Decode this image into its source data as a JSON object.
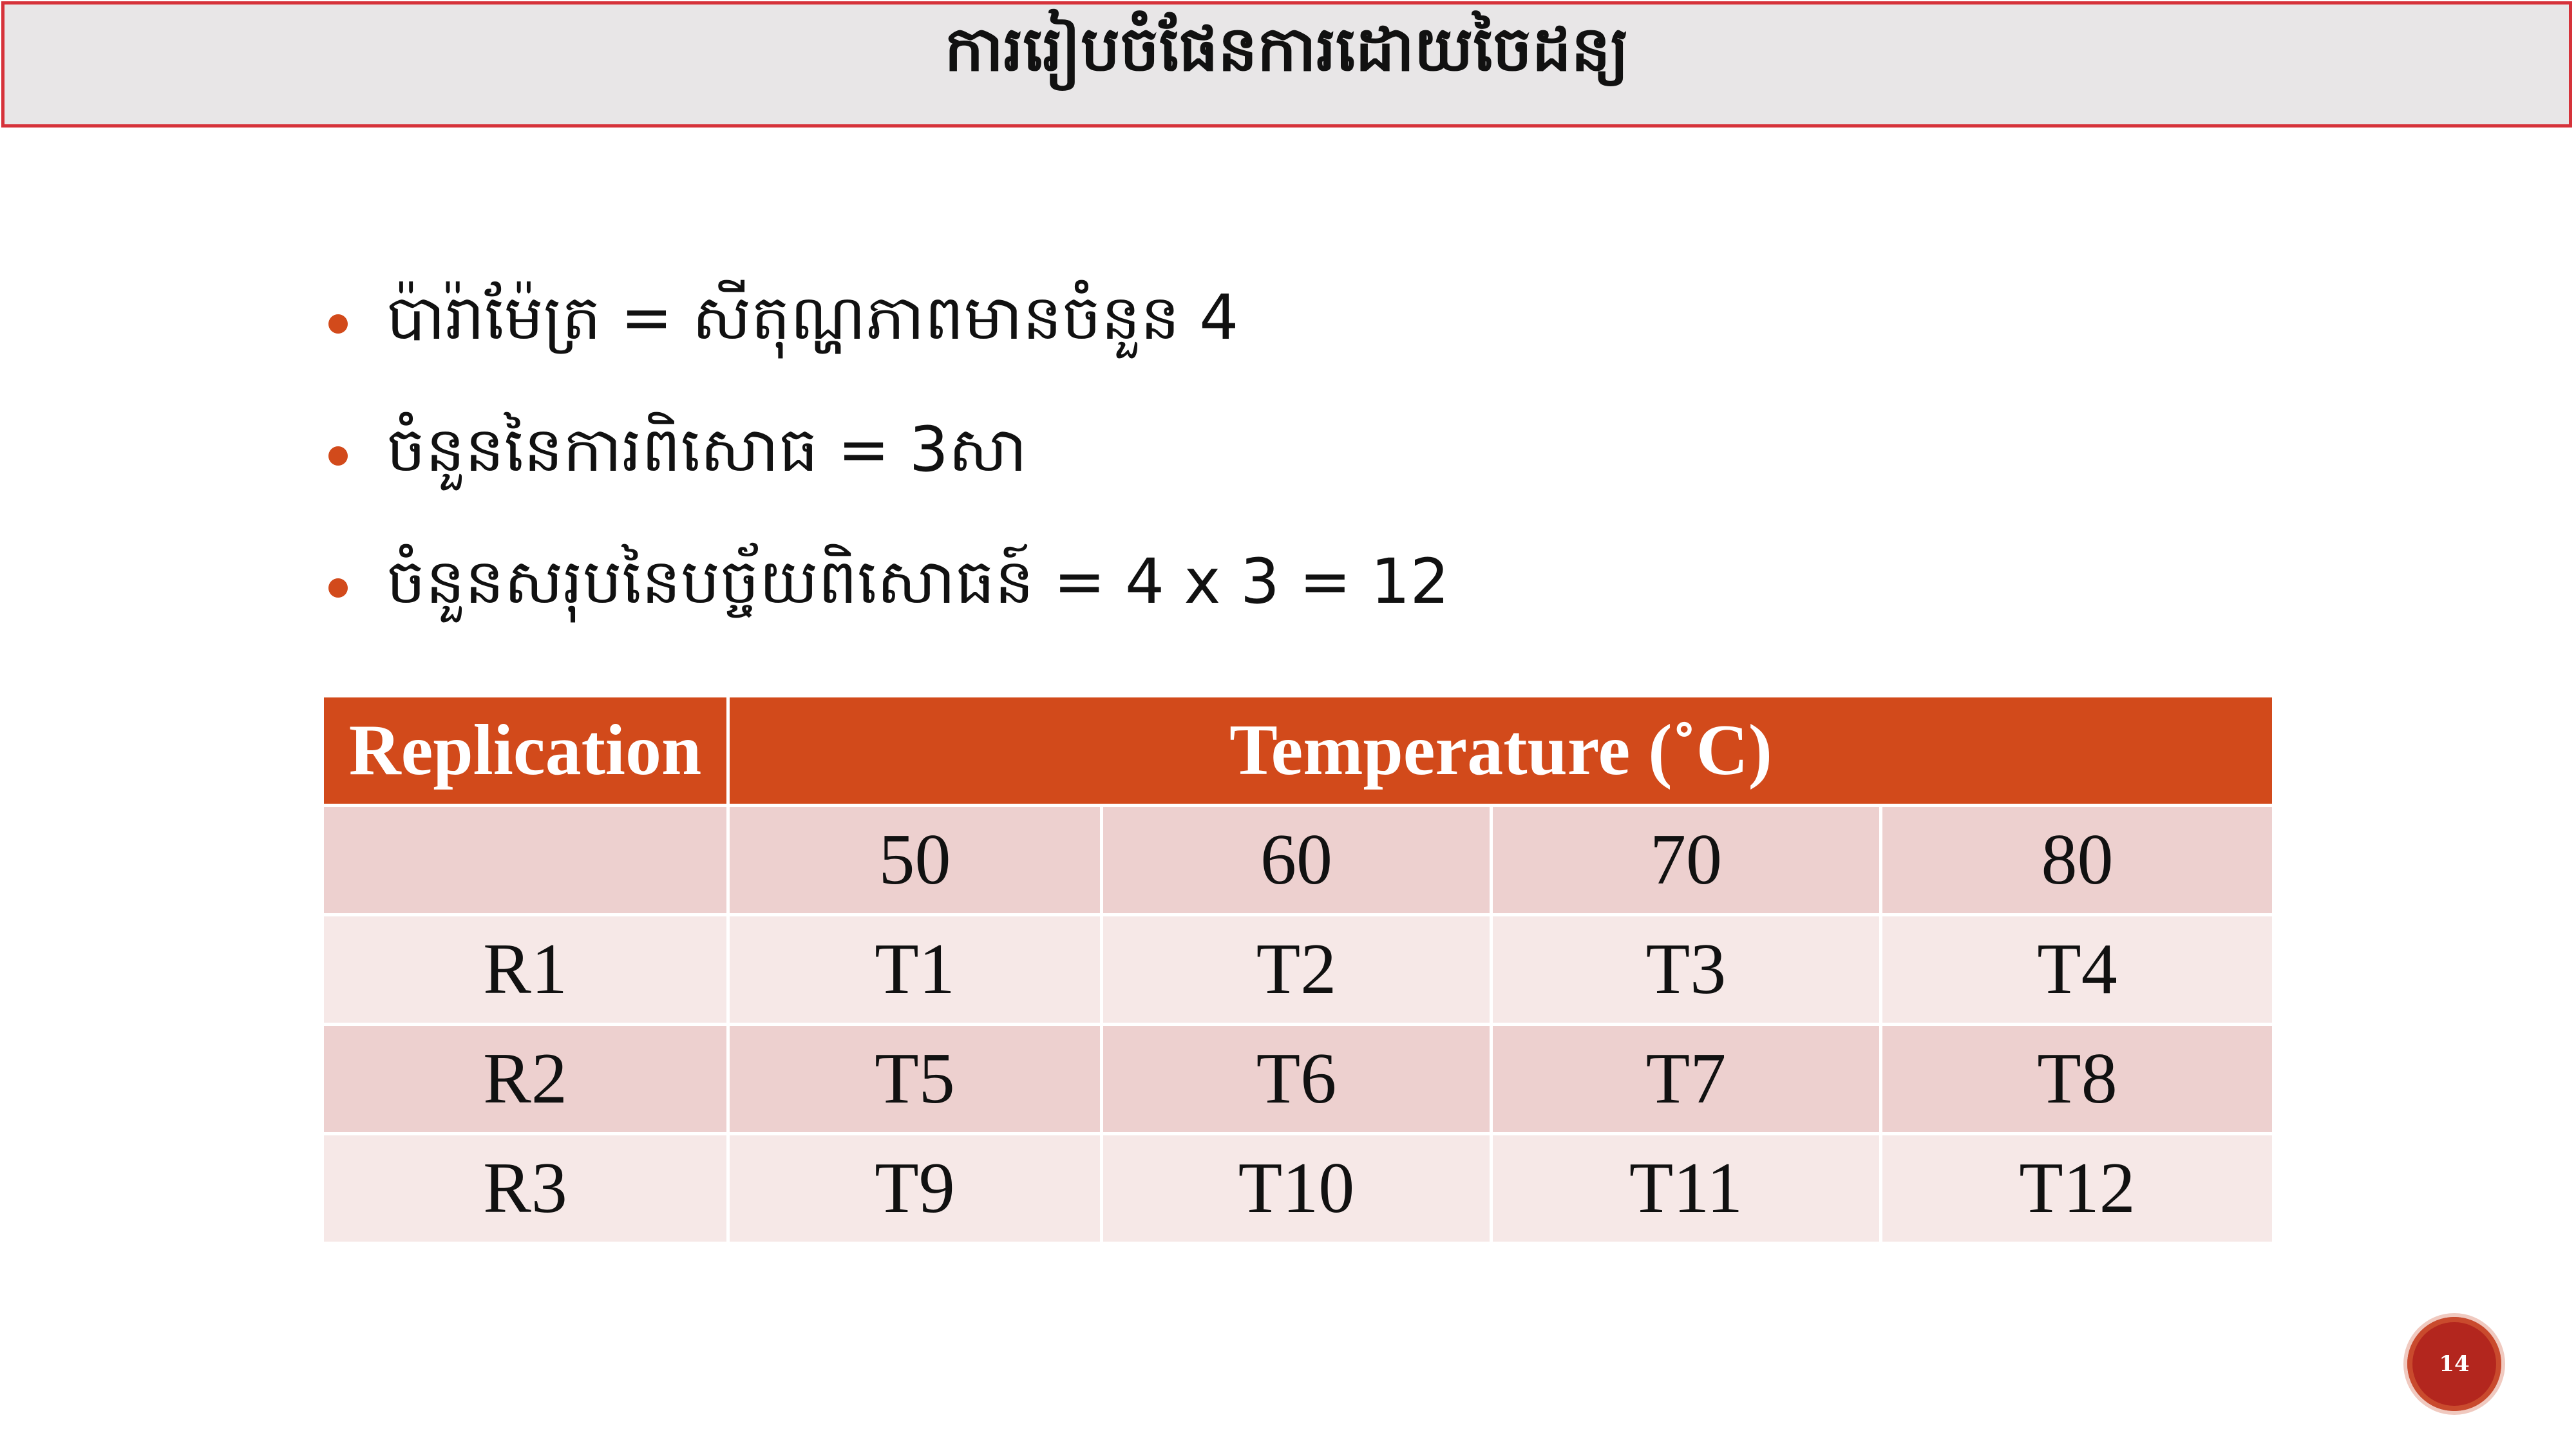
{
  "title": "ការរៀបចំផែនការដោយចៃដន្យ",
  "bullets": [
    {
      "text": "ប៉ារ៉ាម៉ែត្រ  = សីតុណ្ហភាពមានចំនួន 4"
    },
    {
      "text": "ចំនួននៃការពិសោធ = 3សា"
    },
    {
      "text": "ចំនួនសរុបនៃបច្ច័យពិសោធន៍ = 4 x 3 = 12"
    }
  ],
  "table": {
    "header_replication": "Replication",
    "header_temperature": "Temperature (˚C)",
    "temperatures": [
      "50",
      "60",
      "70",
      "80"
    ],
    "rows": [
      {
        "label": "R1",
        "cells": [
          "T1",
          "T2",
          "T3",
          "T4"
        ]
      },
      {
        "label": "R2",
        "cells": [
          "T5",
          "T6",
          "T7",
          "T8"
        ]
      },
      {
        "label": "R3",
        "cells": [
          "T9",
          "T10",
          "T11",
          "T12"
        ]
      }
    ]
  },
  "page_number": "14",
  "colors": {
    "accent": "#d24a1b",
    "title_border": "#d6323a",
    "title_background": "#e8e6e7",
    "row_dark": "#edd0cf",
    "row_light": "#f6e8e7"
  }
}
